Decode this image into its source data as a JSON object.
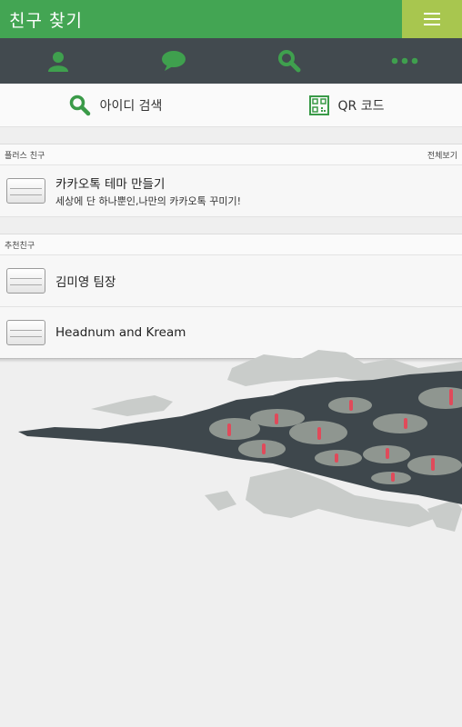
{
  "header": {
    "title": "친구 찾기",
    "menu_icon": "hamburger-menu-icon",
    "color": "#43a553",
    "menu_color": "#a8c64f"
  },
  "tabs": [
    {
      "icon": "person-icon",
      "active": false
    },
    {
      "icon": "chat-bubble-icon",
      "active": false
    },
    {
      "icon": "search-icon",
      "active": true
    },
    {
      "icon": "more-dots-icon",
      "active": false
    }
  ],
  "search_options": {
    "id_search": "아이디 검색",
    "qr_code": "QR 코드"
  },
  "plus_friends": {
    "header": "플러스 친구",
    "see_all": "전체보기",
    "items": [
      {
        "name": "카카오톡 테마 만들기",
        "description": "세상에 단 하나뿐인,나만의 카카오톡 꾸미기!"
      }
    ]
  },
  "recommended": {
    "header": "추천친구",
    "items": [
      {
        "name": "김미영 팀장"
      },
      {
        "name": "Headnum and Kream"
      }
    ]
  },
  "colors": {
    "tabbar": "#424a4f",
    "accent_green": "#43a553",
    "inactive_icon": "#3fa04e"
  }
}
